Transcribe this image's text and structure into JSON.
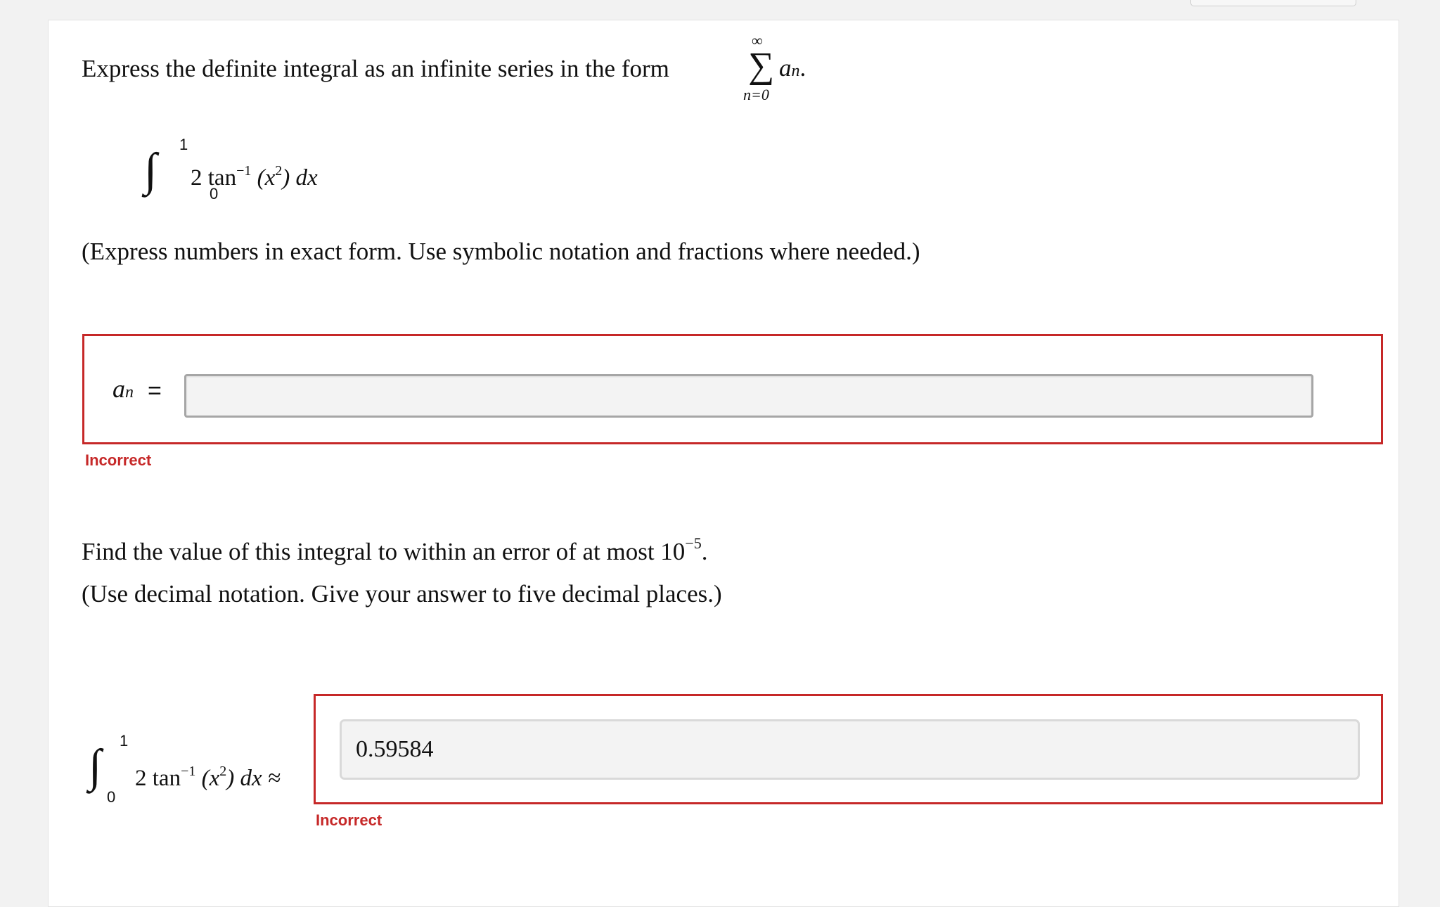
{
  "part1": {
    "prompt": "Express the definite integral as an infinite series in the form",
    "sigma_symbol": "∑",
    "sigma_upper": "∞",
    "sigma_lower": "n=0",
    "sigma_term": "a",
    "sigma_term_sub": "n",
    "sigma_period": ".",
    "integral": {
      "symbol": "∫",
      "upper": "1",
      "lower": "0",
      "coef": "2 tan",
      "inv": "−1",
      "arg_open": " (x",
      "arg_pow": "2",
      "arg_close": ") dx"
    },
    "instruction": "(Express numbers in exact form. Use symbolic notation and fractions where needed.)",
    "answer_label": "a",
    "answer_label_sub": "n",
    "equals": "=",
    "answer_value": "",
    "status": "Incorrect"
  },
  "part2": {
    "prompt_text": "Find the value of this integral to within an error of at most 10",
    "prompt_exp": "−5",
    "prompt_end": ".",
    "instruction": "(Use decimal notation. Give your answer to five decimal places.)",
    "integral": {
      "symbol": "∫",
      "upper": "1",
      "lower": "0",
      "coef": "2 tan",
      "inv": "−1",
      "arg_open": " (x",
      "arg_pow": "2",
      "arg_close": ") dx ≈"
    },
    "answer_value": "0.59584",
    "status": "Incorrect"
  },
  "colors": {
    "error_red": "#c62828",
    "field_bg": "#f3f3f3"
  }
}
